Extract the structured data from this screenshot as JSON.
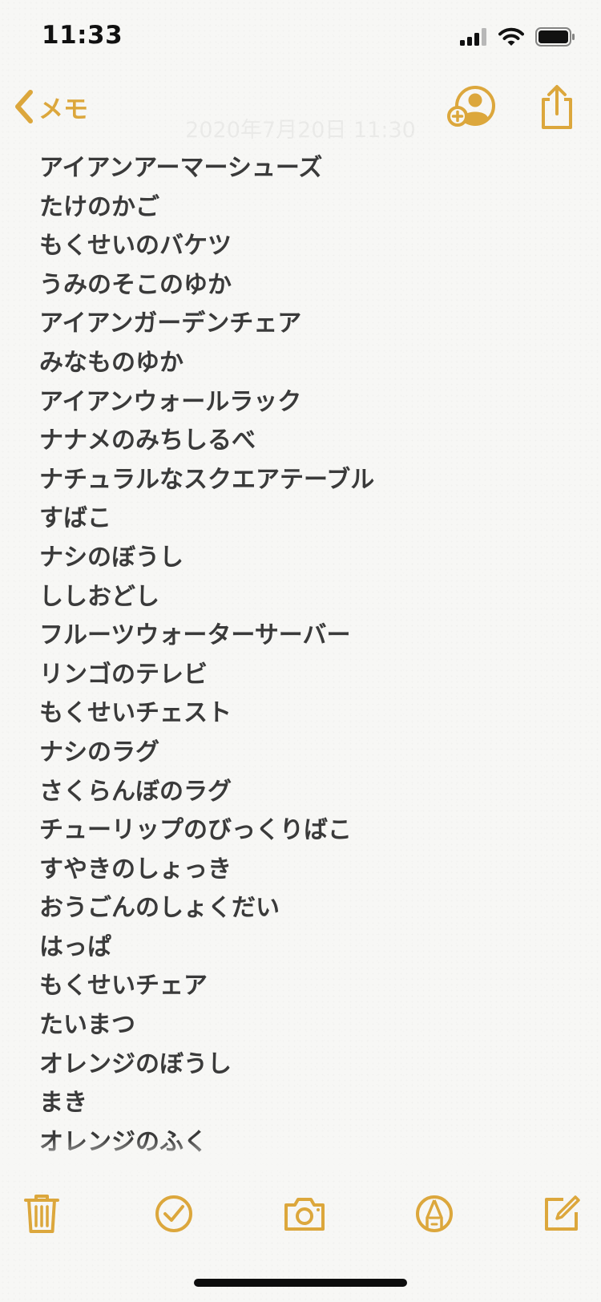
{
  "status_bar": {
    "time": "11:33"
  },
  "nav": {
    "back_label": "メモ",
    "accent_color": "#dca73c"
  },
  "note": {
    "date": "2020年7月20日 11:30",
    "lines": [
      "アイアンアーマーシューズ",
      "たけのかご",
      "もくせいのバケツ",
      "うみのそこのゆか",
      "アイアンガーデンチェア",
      "みなものゆか",
      "アイアンウォールラック",
      "ナナメのみちしるべ",
      "ナチュラルなスクエアテーブル",
      "すばこ",
      "ナシのぼうし",
      "ししおどし",
      "フルーツウォーターサーバー",
      "リンゴのテレビ",
      "もくせいチェスト",
      "ナシのラグ",
      "さくらんぼのラグ",
      "チューリップのびっくりばこ",
      "すやきのしょっき",
      "おうごんのしょくだい",
      "はっぱ",
      "もくせいチェア",
      "たいまつ",
      "オレンジのぼうし",
      "まき",
      "オレンジのふく"
    ]
  },
  "icons": {
    "status": [
      "cellular-signal-icon",
      "wifi-icon",
      "battery-icon"
    ],
    "nav": [
      "chevron-left-icon",
      "add-person-icon",
      "share-icon"
    ],
    "toolbar": [
      "trash-icon",
      "checklist-icon",
      "camera-icon",
      "markup-pen-icon",
      "compose-icon"
    ]
  }
}
